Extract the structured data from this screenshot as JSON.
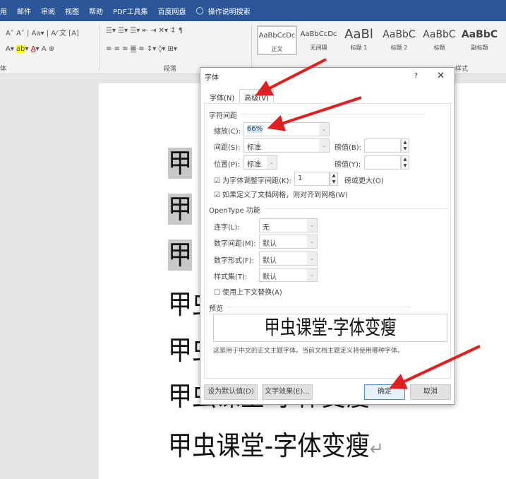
{
  "menu_tabs": [
    "用",
    "邮件",
    "审阅",
    "视图",
    "帮助",
    "PDF工具集",
    "百度网盘",
    "操作说明搜索"
  ],
  "ribbon": {
    "font_group": "体",
    "paragraph_group": "段落",
    "styles_group": "样式",
    "styles": [
      {
        "sample": "AaBbCcDc",
        "label": "正文"
      },
      {
        "sample": "AaBbCcDc",
        "label": "无间隔"
      },
      {
        "sample": "AaBl",
        "label": "标题 1"
      },
      {
        "sample": "AaBbC",
        "label": "标题 2"
      },
      {
        "sample": "AaBbC",
        "label": "标题"
      },
      {
        "sample": "AaBbC",
        "label": "副标题"
      }
    ]
  },
  "document": {
    "lines": [
      "甲虫课堂-字体变瘦",
      "甲虫课堂-字体变瘦",
      "甲虫课堂-字体变瘦",
      "甲虫课堂-字体变瘦",
      "甲虫课堂-字体变瘦",
      "甲虫课堂-字体变瘦",
      "甲虫课堂-字体变瘦"
    ],
    "selected_char": "甲",
    "para_mark": "↵"
  },
  "dialog": {
    "title": "字体",
    "help": "?",
    "close": "✕",
    "tabs": [
      "字体(N)",
      "高级(V)"
    ],
    "active_tab": "高级(V)",
    "spacing_section": "字符间距",
    "scale_label": "缩放(C):",
    "scale_value": "66%",
    "spacing_label": "间距(S):",
    "spacing_value": "标准",
    "spacing_pt_label": "磅值(B):",
    "position_label": "位置(P):",
    "position_value": "标准",
    "position_pt_label": "磅值(Y):",
    "kerning_label": "为字体调整字间距(K):",
    "kerning_value": "1",
    "kerning_suffix": "磅或更大(O)",
    "kerning_checked": true,
    "grid_label": "如果定义了文档网格，则对齐到网格(W)",
    "grid_checked": true,
    "opentype_section": "OpenType 功能",
    "ligatures_label": "连字(L):",
    "ligatures_value": "无",
    "num_spacing_label": "数字间距(M):",
    "num_spacing_value": "默认",
    "num_forms_label": "数字形式(F):",
    "num_forms_value": "默认",
    "stylistic_label": "样式集(T):",
    "stylistic_value": "默认",
    "contextual_label": "使用上下文替换(A)",
    "contextual_checked": false,
    "preview_section": "预览",
    "preview_text": "甲虫课堂-字体变瘦",
    "preview_desc": "这是用于中文的正文主题字体。当前文档主题定义将使用哪种字体。",
    "set_default": "设为默认值(D)",
    "text_effects": "文字效果(E)...",
    "ok": "确定",
    "cancel": "取消"
  },
  "colors": {
    "title_bar": "#2b579a",
    "arrow": "#e02020"
  }
}
